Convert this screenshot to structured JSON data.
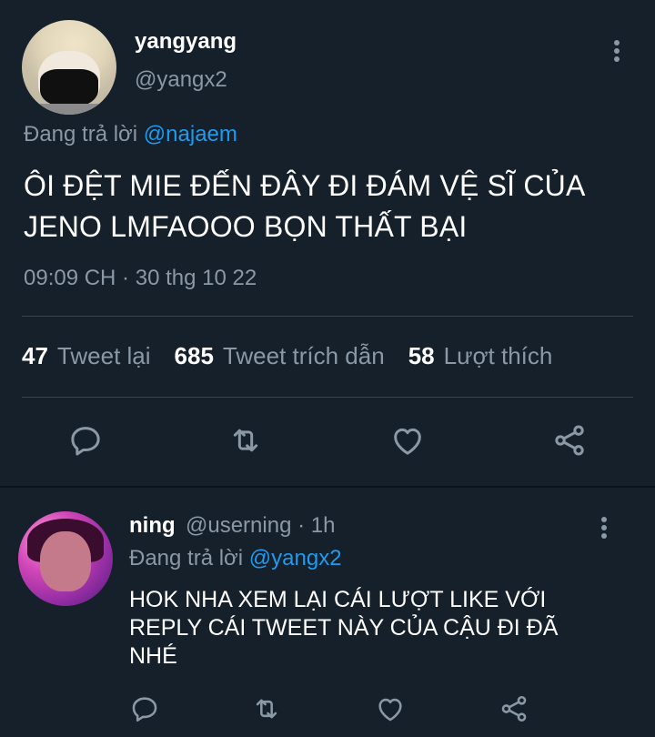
{
  "tweet": {
    "author": {
      "display_name": "yangyang",
      "handle": "@yangx2",
      "avatar_icon": "avatar-photo-masked-person"
    },
    "replying_prefix": "Đang trả lời",
    "replying_to": "@najaem",
    "text": "ÔI ĐỆT MIE ĐẾN ĐÂY ĐI ĐÁM VỆ SĨ CỦA JENO LMFAOOO BỌN THẤT BẠI",
    "timestamp": "09:09 CH · 30 thg 10 22",
    "stats": {
      "retweets": "47",
      "retweets_label": "Tweet lại",
      "quotes": "685",
      "quotes_label": "Tweet trích dẫn",
      "likes": "58",
      "likes_label": "Lượt thích"
    },
    "actions": [
      "reply-icon",
      "retweet-icon",
      "like-icon",
      "share-icon"
    ],
    "more_icon": "more-vertical-icon"
  },
  "reply": {
    "author": {
      "display_name": "ning",
      "handle_time": "@userning · 1h",
      "avatar_icon": "avatar-photo-person-pink-light"
    },
    "replying_prefix": "Đang trả lời",
    "replying_to": "@yangx2",
    "text": "HOK NHA XEM LẠI CÁI LƯỢT LIKE VỚI REPLY CÁI TWEET NÀY CỦA CẬU ĐI ĐÃ NHÉ",
    "actions": [
      "reply-icon",
      "retweet-icon",
      "like-icon",
      "share-icon"
    ],
    "more_icon": "more-vertical-icon"
  },
  "colors": {
    "background": "#15202b",
    "text": "#ffffff",
    "muted": "#8b98a5",
    "link": "#1d9bf0",
    "divider": "#38444d"
  }
}
